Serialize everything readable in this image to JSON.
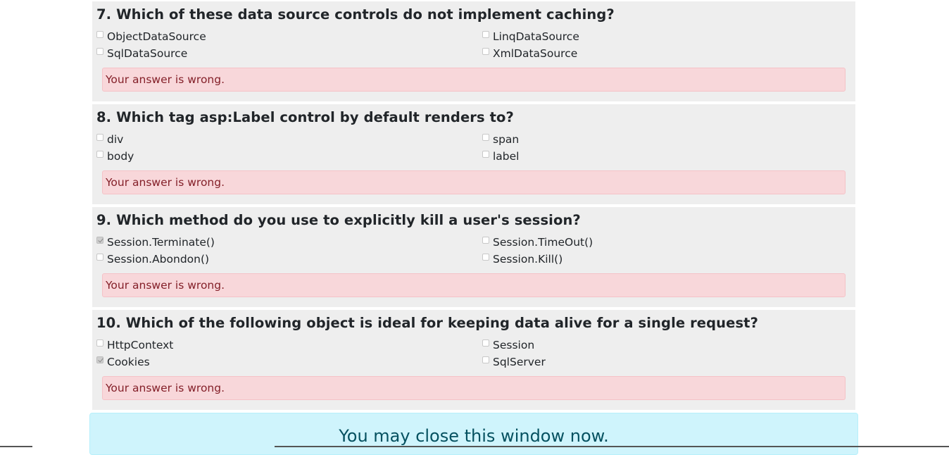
{
  "questions": [
    {
      "title": "7. Which of these data source controls do not implement caching?",
      "options": [
        {
          "label": "ObjectDataSource",
          "checked": false
        },
        {
          "label": "LinqDataSource",
          "checked": false
        },
        {
          "label": "SqlDataSource",
          "checked": false
        },
        {
          "label": "XmlDataSource",
          "checked": false
        }
      ],
      "feedback": "Your answer is wrong."
    },
    {
      "title": "8. Which tag asp:Label control by default renders to?",
      "options": [
        {
          "label": "div",
          "checked": false
        },
        {
          "label": "span",
          "checked": false
        },
        {
          "label": "body",
          "checked": false
        },
        {
          "label": "label",
          "checked": false
        }
      ],
      "feedback": "Your answer is wrong."
    },
    {
      "title": "9. Which method do you use to explicitly kill a user's session?",
      "options": [
        {
          "label": "Session.Terminate()",
          "checked": true
        },
        {
          "label": "Session.TimeOut()",
          "checked": false
        },
        {
          "label": "Session.Abondon()",
          "checked": false
        },
        {
          "label": "Session.Kill()",
          "checked": false
        }
      ],
      "feedback": "Your answer is wrong."
    },
    {
      "title": "10. Which of the following object is ideal for keeping data alive for a single request?",
      "options": [
        {
          "label": "HttpContext",
          "checked": false
        },
        {
          "label": "Session",
          "checked": false
        },
        {
          "label": "Cookies",
          "checked": true
        },
        {
          "label": "SqlServer",
          "checked": false
        }
      ],
      "feedback": "Your answer is wrong."
    }
  ],
  "footer": {
    "message": "You may close this window now."
  },
  "colors": {
    "question_bg": "#eeeeee",
    "danger_bg": "#f8d7da",
    "danger_text": "#842029",
    "info_bg": "#cff4fc",
    "info_text": "#055160"
  }
}
